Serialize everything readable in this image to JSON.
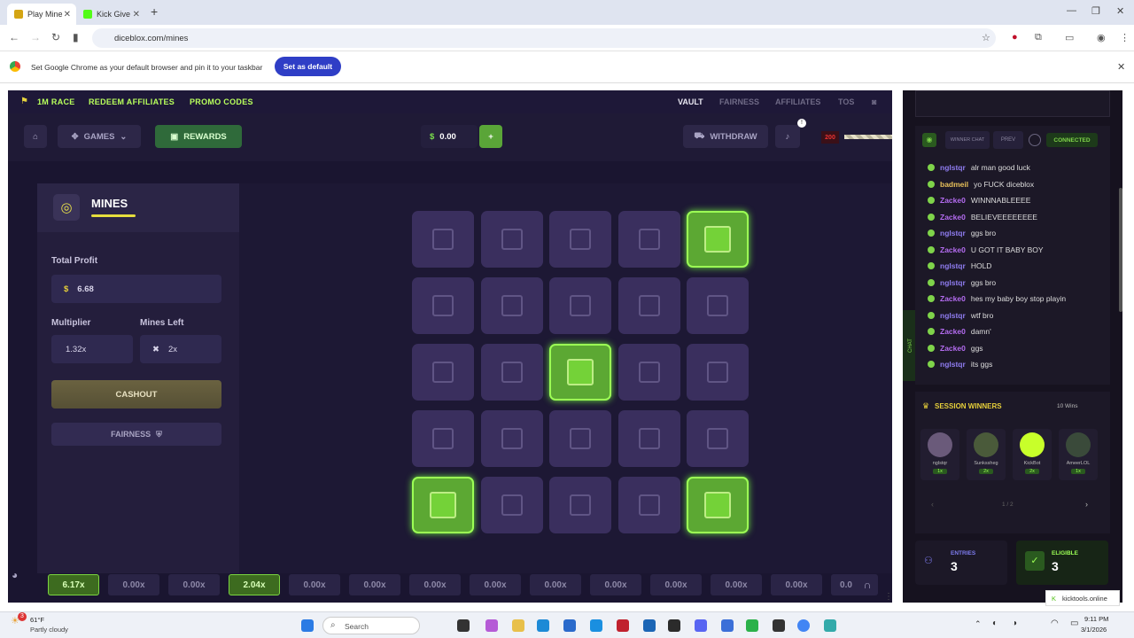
{
  "browser": {
    "tabs": [
      {
        "label": "Play Mine",
        "active": true
      },
      {
        "label": "Kick Give",
        "active": false
      }
    ],
    "url": "diceblox.com/mines",
    "infobar": {
      "text": "Set Google Chrome as your default browser and pin it to your taskbar",
      "button": "Set as default"
    }
  },
  "site": {
    "topnav_left": [
      "1M RACE",
      "REDEEM AFFILIATES",
      "PROMO CODES"
    ],
    "topnav_right": [
      "VAULT",
      "FAIRNESS",
      "AFFILIATES",
      "TOS"
    ],
    "games_label": "GAMES",
    "rewards_label": "REWARDS",
    "balance": "0.00",
    "withdraw_label": "WITHDRAW",
    "notif_count": "!",
    "level": "200",
    "game_title": "MINES",
    "total_profit_label": "Total Profit",
    "total_profit": "6.68",
    "multiplier_label": "Multiplier",
    "multiplier": "1.32x",
    "mines_left_label": "Mines Left",
    "mines_left": "2x",
    "cashout_label": "CASHOUT",
    "fairness_label": "FAIRNESS",
    "gems": [
      [
        0,
        4
      ],
      [
        2,
        2
      ],
      [
        4,
        0
      ],
      [
        4,
        4
      ]
    ],
    "multipliers": [
      {
        "v": "6.17x",
        "win": true
      },
      {
        "v": "0.00x",
        "win": false
      },
      {
        "v": "0.00x",
        "win": false
      },
      {
        "v": "2.04x",
        "win": true
      },
      {
        "v": "0.00x",
        "win": false
      },
      {
        "v": "0.00x",
        "win": false
      },
      {
        "v": "0.00x",
        "win": false
      },
      {
        "v": "0.00x",
        "win": false
      },
      {
        "v": "0.00x",
        "win": false
      },
      {
        "v": "0.00x",
        "win": false
      },
      {
        "v": "0.00x",
        "win": false
      },
      {
        "v": "0.00x",
        "win": false
      },
      {
        "v": "0.00x",
        "win": false
      },
      {
        "v": "0.0",
        "win": false
      }
    ]
  },
  "chat": {
    "tabs": [
      "WINNER CHAT",
      "PREV"
    ],
    "status": "CONNECTED",
    "side_label": "CHAT",
    "messages": [
      {
        "user": "nglstqr",
        "text": "alr man good luck",
        "color": "#8f7cf0"
      },
      {
        "user": "badmeil",
        "text": "yo FUCK diceblox",
        "color": "#e8c15a"
      },
      {
        "user": "Zacke0",
        "text": "WINNNABLEEEE",
        "color": "#b46cf0"
      },
      {
        "user": "Zacke0",
        "text": "BELIEVEEEEEEEE",
        "color": "#b46cf0"
      },
      {
        "user": "nglstqr",
        "text": "ggs bro",
        "color": "#8f7cf0"
      },
      {
        "user": "Zacke0",
        "text": "U GOT IT BABY BOY",
        "color": "#b46cf0"
      },
      {
        "user": "nglstqr",
        "text": "HOLD",
        "color": "#8f7cf0"
      },
      {
        "user": "nglstqr",
        "text": "ggs bro",
        "color": "#8f7cf0"
      },
      {
        "user": "Zacke0",
        "text": "hes my baby boy stop playin",
        "color": "#b46cf0"
      },
      {
        "user": "nglstqr",
        "text": "wtf bro",
        "color": "#8f7cf0"
      },
      {
        "user": "Zacke0",
        "text": "damn'",
        "color": "#b46cf0"
      },
      {
        "user": "Zacke0",
        "text": "ggs",
        "color": "#b46cf0"
      },
      {
        "user": "nglstqr",
        "text": "its ggs",
        "color": "#8f7cf0"
      }
    ]
  },
  "session": {
    "title": "SESSION WINNERS",
    "wins": "10 Wins",
    "winners": [
      {
        "name": "nglstqr",
        "badge": "1x"
      },
      {
        "name": "Sunkssheg",
        "badge": "2x"
      },
      {
        "name": "KickBot",
        "badge": "2x"
      },
      {
        "name": "AmeerLOL",
        "badge": "1x"
      }
    ],
    "pager": "1 / 2",
    "entries_label": "ENTRIES",
    "entries": "3",
    "eligible_label": "ELIGIBLE",
    "eligible": "3"
  },
  "kicktools": "kicktools.online",
  "taskbar": {
    "weather_temp": "61°F",
    "weather_desc": "Partly cloudy",
    "search": "Search",
    "time": "9:11 PM",
    "date": "3/1/2026",
    "badge": "3"
  },
  "colors": {
    "accent_green": "#9cff55",
    "bg": "#1a1530"
  }
}
